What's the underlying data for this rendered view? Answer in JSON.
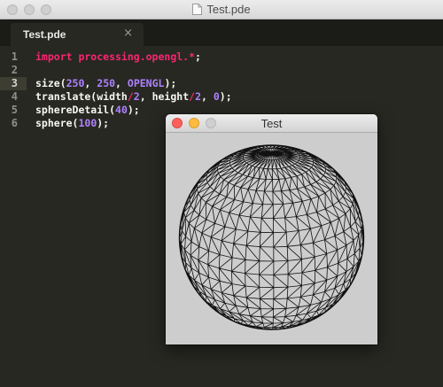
{
  "window": {
    "title": "Test.pde",
    "icon": "document-icon"
  },
  "tabs": [
    {
      "label": "Test.pde",
      "close": "×"
    }
  ],
  "editor": {
    "line_numbers": [
      "1",
      "2",
      "3",
      "4",
      "5",
      "6"
    ],
    "active_line": 3,
    "lines": [
      [
        {
          "t": "import processing.opengl.",
          "c": "kw"
        },
        {
          "t": "*",
          "c": "op"
        },
        {
          "t": ";",
          "c": ""
        }
      ],
      [],
      [
        {
          "t": "size(",
          "c": ""
        },
        {
          "t": "250",
          "c": "num"
        },
        {
          "t": ", ",
          "c": ""
        },
        {
          "t": "250",
          "c": "num"
        },
        {
          "t": ", ",
          "c": ""
        },
        {
          "t": "OPENGL",
          "c": "const"
        },
        {
          "t": ");",
          "c": ""
        }
      ],
      [
        {
          "t": "translate(width",
          "c": ""
        },
        {
          "t": "/",
          "c": "op"
        },
        {
          "t": "2",
          "c": "num"
        },
        {
          "t": ", height",
          "c": ""
        },
        {
          "t": "/",
          "c": "op"
        },
        {
          "t": "2",
          "c": "num"
        },
        {
          "t": ", ",
          "c": ""
        },
        {
          "t": "0",
          "c": "num"
        },
        {
          "t": ");",
          "c": ""
        }
      ],
      [
        {
          "t": "sphereDetail(",
          "c": ""
        },
        {
          "t": "40",
          "c": "num"
        },
        {
          "t": ");",
          "c": ""
        }
      ],
      [
        {
          "t": "sphere(",
          "c": ""
        },
        {
          "t": "100",
          "c": "num"
        },
        {
          "t": ");",
          "c": ""
        }
      ]
    ]
  },
  "sketch_window": {
    "title": "Test",
    "background": "#cdcdcd",
    "content": "wireframe-sphere"
  },
  "colors": {
    "editor_bg": "#272822",
    "keyword": "#f92672",
    "number": "#ae81ff",
    "text": "#f8f8f2",
    "close_button": "#fc605b",
    "minimize_button": "#fdbc40",
    "zoom_button_disabled": "#cfcfcf"
  }
}
